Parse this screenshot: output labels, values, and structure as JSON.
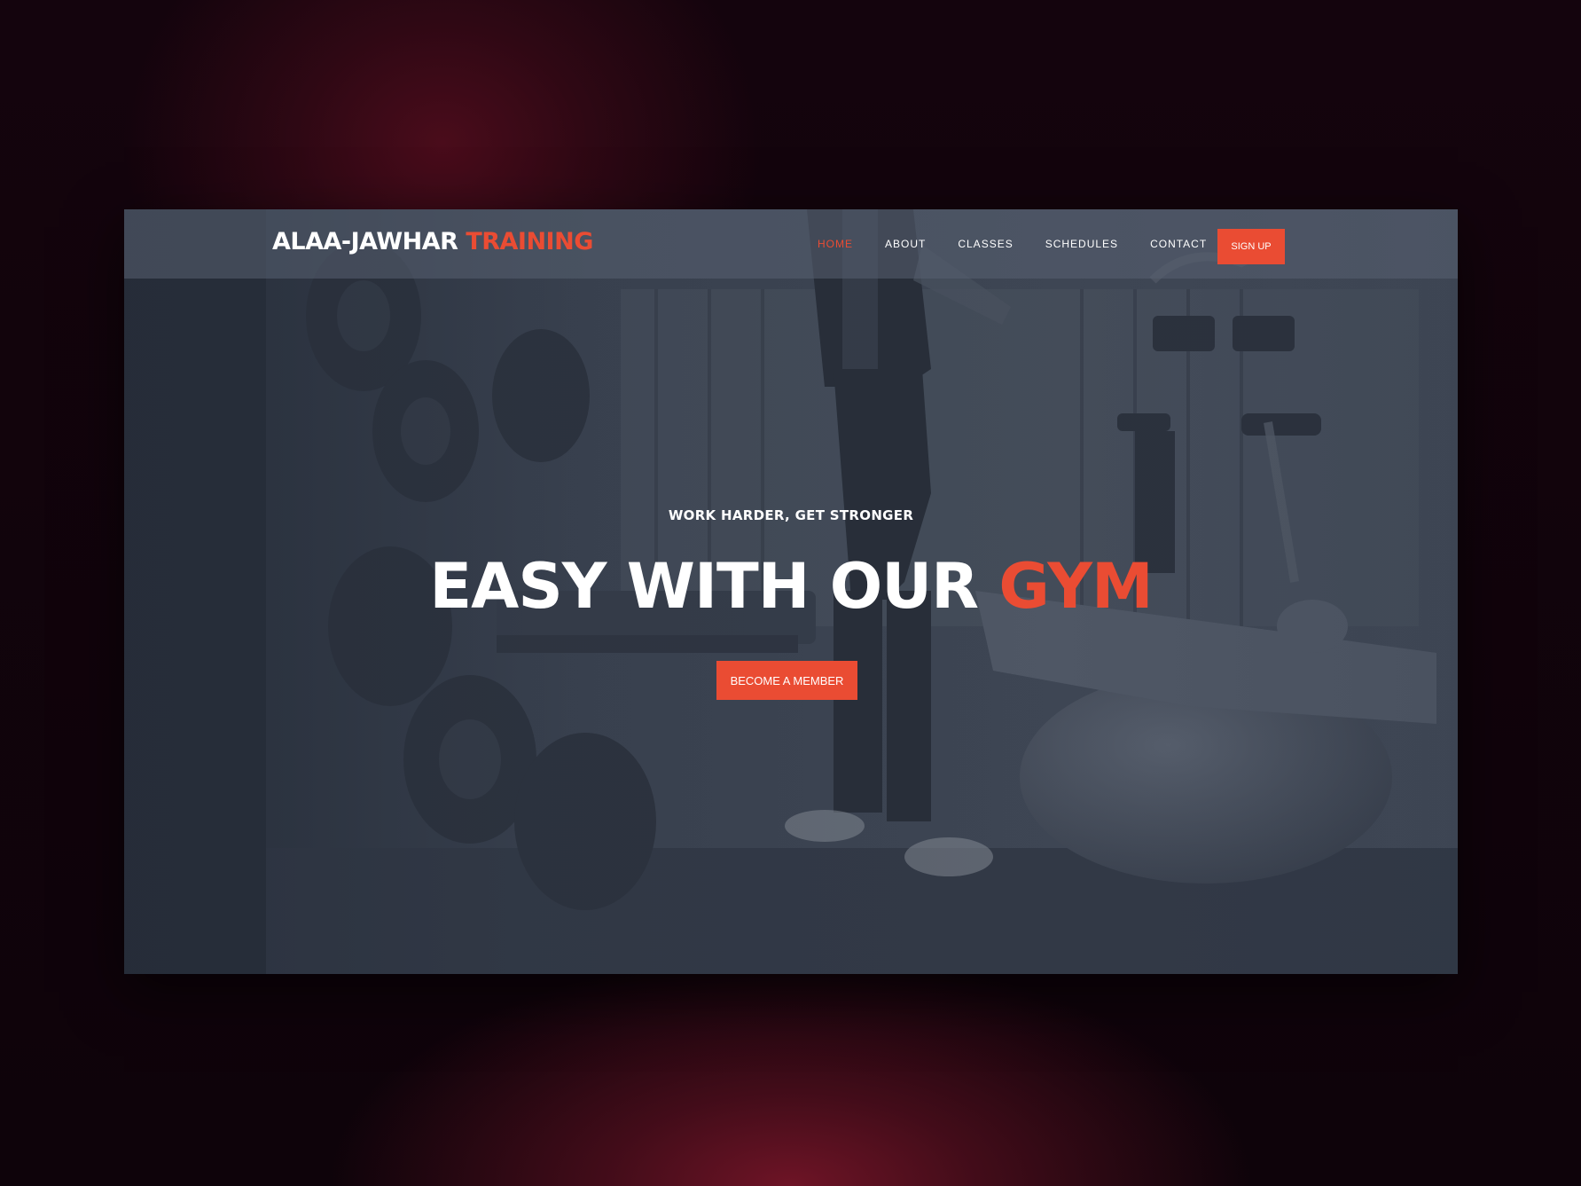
{
  "brand": {
    "name_part1": "ALAA-JAWHAR",
    "name_part2": "TRAINING"
  },
  "nav": {
    "items": [
      {
        "label": "HOME",
        "active": true
      },
      {
        "label": "ABOUT",
        "active": false
      },
      {
        "label": "CLASSES",
        "active": false
      },
      {
        "label": "SCHEDULES",
        "active": false
      },
      {
        "label": "CONTACT",
        "active": false
      }
    ],
    "signup_label": "SIGN UP"
  },
  "hero": {
    "tagline": "WORK HARDER, GET STRONGER",
    "headline_part1": "EASY WITH OUR",
    "headline_part2": "GYM",
    "cta_label": "BECOME A MEMBER"
  },
  "colors": {
    "accent": "#ea4c33",
    "overlay": "#2d3441",
    "text": "#ffffff"
  }
}
